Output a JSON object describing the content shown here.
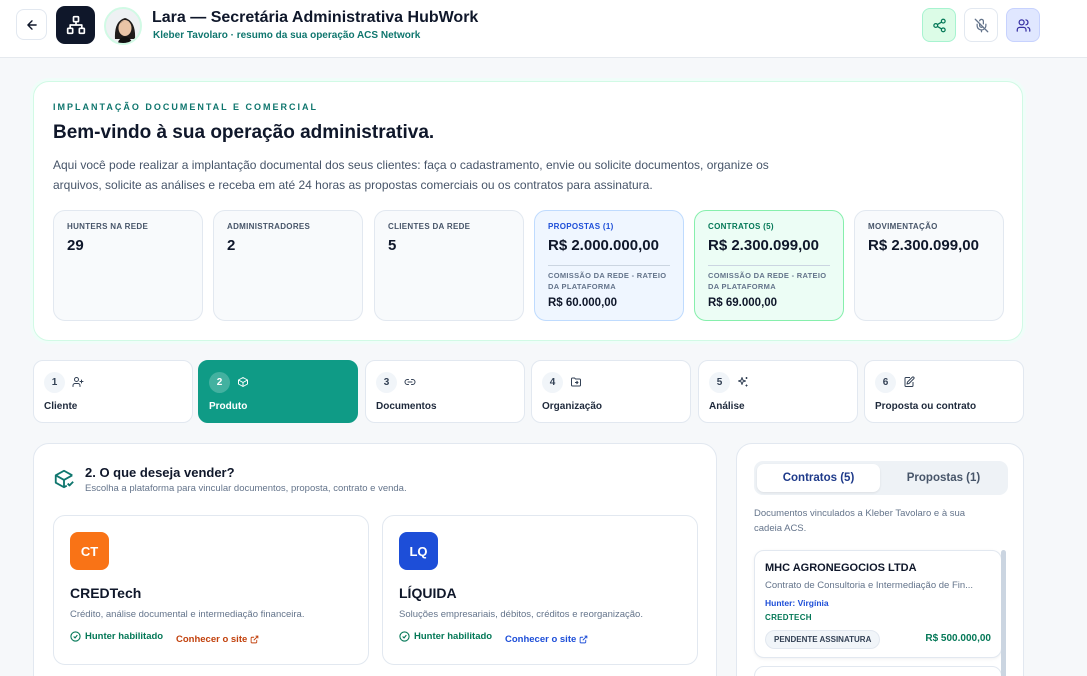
{
  "header": {
    "title": "Lara — Secretária Administrativa HubWork",
    "subtitle": "Kleber Tavolaro · resumo da sua operação ACS Network",
    "icons": [
      "arrow-left-icon",
      "network-icon",
      "share-icon",
      "mic-off-icon",
      "users-icon"
    ]
  },
  "hero": {
    "eyebrow": "IMPLANTAÇÃO DOCUMENTAL E COMERCIAL",
    "title": "Bem-vindo à sua operação administrativa.",
    "description": "Aqui você pode realizar a implantação documental dos seus clientes: faça o cadastramento, envie ou solicite documentos, organize os arquivos, solicite as análises e receba em até 24 horas as propostas comerciais ou os contratos para assinatura.",
    "stats": [
      {
        "label": "HUNTERS NA REDE",
        "value": "29"
      },
      {
        "label": "ADMINISTRADORES",
        "value": "2"
      },
      {
        "label": "CLIENTES DA REDE",
        "value": "5"
      },
      {
        "label": "PROPOSTAS (1)",
        "value": "R$ 2.000.000,00",
        "sub_label": "COMISSÃO DA REDE - RATEIO DA PLATAFORMA",
        "sub_value": "R$ 60.000,00"
      },
      {
        "label": "CONTRATOS (5)",
        "value": "R$ 2.300.099,00",
        "sub_label": "COMISSÃO DA REDE - RATEIO DA PLATAFORMA",
        "sub_value": "R$ 69.000,00"
      },
      {
        "label": "MOVIMENTAÇÃO",
        "value": "R$ 2.300.099,00"
      }
    ]
  },
  "steps": [
    {
      "num": "1",
      "label": "Cliente",
      "icon": "user-plus-icon"
    },
    {
      "num": "2",
      "label": "Produto",
      "icon": "box-icon",
      "active": true
    },
    {
      "num": "3",
      "label": "Documentos",
      "icon": "link-icon"
    },
    {
      "num": "4",
      "label": "Organização",
      "icon": "folder-icon"
    },
    {
      "num": "5",
      "label": "Análise",
      "icon": "sparkles-icon"
    },
    {
      "num": "6",
      "label": "Proposta ou contrato",
      "icon": "edit-icon"
    }
  ],
  "product_panel": {
    "title": "2. O que deseja vender?",
    "subtitle": "Escolha a plataforma para vincular documentos, proposta, contrato e venda.",
    "products": [
      {
        "badge": "CT",
        "color": "#f97316",
        "name": "CREDTech",
        "description": "Crédito, análise documental e intermediação financeira.",
        "hunter": "Hunter habilitado",
        "link": "Conhecer o site",
        "link_color": "#c2410c"
      },
      {
        "badge": "LQ",
        "color": "#1d4ed8",
        "name": "LÍQUIDA",
        "description": "Soluções empresariais, débitos, créditos e reorganização.",
        "hunter": "Hunter habilitado",
        "link": "Conhecer o site",
        "link_color": "#1d4ed8"
      }
    ]
  },
  "side_panel": {
    "tabs": [
      "Contratos (5)",
      "Propostas (1)"
    ],
    "description": "Documentos vinculados a Kleber Tavolaro e à sua cadeia ACS.",
    "documents": [
      {
        "company": "MHC AGRONEGOCIOS LTDA",
        "title": "Contrato de Consultoria e Intermediação de Fin...",
        "hunter": "Hunter: Virgínia",
        "product": "CREDTECH",
        "status": "PENDENTE ASSINATURA",
        "amount": "R$ 500.000,00"
      }
    ]
  }
}
